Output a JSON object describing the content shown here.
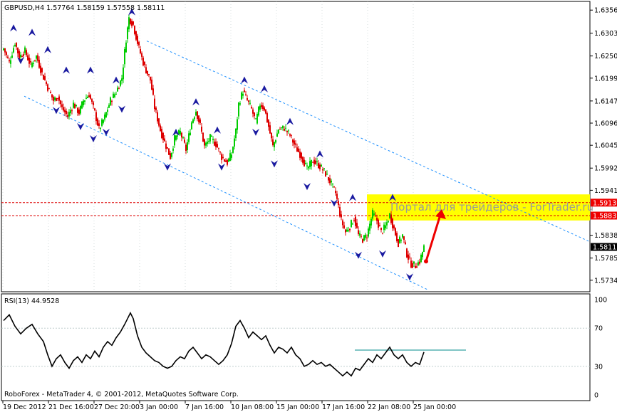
{
  "colors": {
    "background": "#ffffff",
    "grid": "#b8c8c8",
    "frame": "#000000",
    "candle_bull": "#00cc00",
    "candle_bear": "#dd0000",
    "channel": "#1e90ff",
    "fractal": "#1a1aa0",
    "level": "#dd0000",
    "target_zone": "#ffff00",
    "arrow": "#ee0000",
    "rsi_line": "#000000",
    "rsi_resistance": "#008b8b",
    "price_label_bg": "#000000",
    "level_label_bg": "#ee0000"
  },
  "header": {
    "symbol_text": "GBPUSD,H4  1.57764  1.58159  1.57558  1.58111"
  },
  "watermark": {
    "text": "Портал для трейдеров - ForTrader.ru"
  },
  "footer": {
    "copyright": "RoboForex - MetaTrader 4, © 2001-2012, MetaQuotes Software Corp."
  },
  "chart_data": [
    {
      "type": "candlestick",
      "symbol": "GBPUSD",
      "timeframe": "H4",
      "ohlc_last": {
        "open": 1.57764,
        "high": 1.58159,
        "low": 1.57558,
        "close": 1.58111
      },
      "current_price": "1.58111",
      "y_axis": {
        "range": [
          1.5708,
          1.6376
        ],
        "ticks": [
          "1.63560",
          "1.63030",
          "1.62505",
          "1.61995",
          "1.61470",
          "1.60960",
          "1.60450",
          "1.59925",
          "1.59415",
          "1.58380",
          "1.57855",
          "1.57345"
        ]
      },
      "x_axis": {
        "ticks": [
          "19 Dec 2012",
          "21 Dec 16:00",
          "27 Dec 20:00",
          "3 Jan 00:00",
          "7 Jan 16:00",
          "10 Jan 08:00",
          "15 Jan 00:00",
          "17 Jan 16:00",
          "22 Jan 08:00",
          "25 Jan 00:00"
        ]
      },
      "levels": [
        {
          "label": "1.59130",
          "value": 1.5913
        },
        {
          "label": "1.58832",
          "value": 1.58832
        }
      ],
      "target_zone": [
        1.5872,
        1.5932
      ],
      "close_path": [
        [
          0,
          1.6268
        ],
        [
          8,
          1.6235
        ],
        [
          16,
          1.6282
        ],
        [
          22,
          1.6248
        ],
        [
          30,
          1.6262
        ],
        [
          38,
          1.6228
        ],
        [
          46,
          1.625
        ],
        [
          54,
          1.621
        ],
        [
          62,
          1.6178
        ],
        [
          70,
          1.6148
        ],
        [
          76,
          1.6158
        ],
        [
          82,
          1.613
        ],
        [
          90,
          1.6112
        ],
        [
          98,
          1.614
        ],
        [
          106,
          1.612
        ],
        [
          112,
          1.6148
        ],
        [
          120,
          1.6162
        ],
        [
          128,
          1.612
        ],
        [
          134,
          1.6082
        ],
        [
          142,
          1.611
        ],
        [
          150,
          1.6148
        ],
        [
          158,
          1.6168
        ],
        [
          166,
          1.62
        ],
        [
          172,
          1.629
        ],
        [
          176,
          1.6338
        ],
        [
          182,
          1.6322
        ],
        [
          190,
          1.6268
        ],
        [
          198,
          1.6225
        ],
        [
          206,
          1.6195
        ],
        [
          212,
          1.6132
        ],
        [
          220,
          1.608
        ],
        [
          226,
          1.6052
        ],
        [
          234,
          1.6018
        ],
        [
          240,
          1.606
        ],
        [
          248,
          1.6075
        ],
        [
          256,
          1.6035
        ],
        [
          264,
          1.6098
        ],
        [
          270,
          1.6125
        ],
        [
          276,
          1.609
        ],
        [
          282,
          1.6042
        ],
        [
          290,
          1.6062
        ],
        [
          298,
          1.6048
        ],
        [
          306,
          1.6018
        ],
        [
          314,
          1.6005
        ],
        [
          320,
          1.6025
        ],
        [
          326,
          1.6078
        ],
        [
          330,
          1.614
        ],
        [
          336,
          1.617
        ],
        [
          342,
          1.6148
        ],
        [
          348,
          1.6128
        ],
        [
          354,
          1.6098
        ],
        [
          360,
          1.614
        ],
        [
          366,
          1.613
        ],
        [
          372,
          1.6088
        ],
        [
          378,
          1.6042
        ],
        [
          386,
          1.6082
        ],
        [
          394,
          1.6085
        ],
        [
          402,
          1.6068
        ],
        [
          410,
          1.604
        ],
        [
          418,
          1.602
        ],
        [
          426,
          1.599
        ],
        [
          434,
          1.601
        ],
        [
          442,
          1.6
        ],
        [
          450,
          1.5985
        ],
        [
          458,
          1.5962
        ],
        [
          466,
          1.5935
        ],
        [
          474,
          1.5872
        ],
        [
          480,
          1.5845
        ],
        [
          486,
          1.5858
        ],
        [
          492,
          1.5878
        ],
        [
          498,
          1.5838
        ],
        [
          504,
          1.5828
        ],
        [
          510,
          1.5838
        ],
        [
          518,
          1.5888
        ],
        [
          524,
          1.5872
        ],
        [
          530,
          1.5845
        ],
        [
          536,
          1.5858
        ],
        [
          542,
          1.5885
        ],
        [
          548,
          1.5852
        ],
        [
          554,
          1.582
        ],
        [
          560,
          1.5838
        ],
        [
          566,
          1.5795
        ],
        [
          572,
          1.5772
        ],
        [
          578,
          1.5768
        ],
        [
          584,
          1.5778
        ],
        [
          590,
          1.5811
        ]
      ],
      "fractals_up": [
        [
          14,
          1.6315
        ],
        [
          40,
          1.6305
        ],
        [
          62,
          1.6265
        ],
        [
          88,
          1.6218
        ],
        [
          122,
          1.6218
        ],
        [
          158,
          1.6195
        ],
        [
          180,
          1.6352
        ],
        [
          242,
          1.6075
        ],
        [
          270,
          1.6145
        ],
        [
          300,
          1.608
        ],
        [
          338,
          1.6195
        ],
        [
          366,
          1.6175
        ],
        [
          402,
          1.61
        ],
        [
          444,
          1.6025
        ],
        [
          490,
          1.5925
        ],
        [
          546,
          1.5925
        ]
      ],
      "fractals_down": [
        [
          24,
          1.624
        ],
        [
          74,
          1.6125
        ],
        [
          108,
          1.6088
        ],
        [
          126,
          1.606
        ],
        [
          144,
          1.6075
        ],
        [
          166,
          1.6128
        ],
        [
          230,
          1.5995
        ],
        [
          306,
          1.5995
        ],
        [
          354,
          1.6075
        ],
        [
          380,
          1.6002
        ],
        [
          426,
          1.595
        ],
        [
          464,
          1.5912
        ],
        [
          498,
          1.5792
        ],
        [
          532,
          1.5795
        ],
        [
          570,
          1.5742
        ]
      ],
      "channel_lines": [
        {
          "from": [
            206,
            1.6285
          ],
          "to": [
            828,
            1.5823
          ]
        },
        {
          "from": [
            34,
            1.6158
          ],
          "to": [
            600,
            1.5713
          ]
        }
      ],
      "arrow": {
        "from": [
          598,
          1.5778
        ],
        "to": [
          620,
          1.5898
        ]
      }
    },
    {
      "type": "line",
      "indicator": "RSI",
      "label": "RSI(13) 44.9528",
      "value": 44.9528,
      "y_axis": {
        "range": [
          0,
          100
        ],
        "ticks": [
          "100",
          "70",
          "30",
          "0"
        ]
      },
      "levels": [
        70,
        30
      ],
      "resistance_line": {
        "from": [
          498,
          47
        ],
        "to": [
          654,
          47
        ]
      },
      "series": [
        [
          0,
          78
        ],
        [
          8,
          84
        ],
        [
          16,
          72
        ],
        [
          24,
          64
        ],
        [
          32,
          70
        ],
        [
          40,
          74
        ],
        [
          48,
          64
        ],
        [
          56,
          56
        ],
        [
          62,
          42
        ],
        [
          68,
          30
        ],
        [
          74,
          38
        ],
        [
          80,
          42
        ],
        [
          86,
          34
        ],
        [
          92,
          28
        ],
        [
          98,
          36
        ],
        [
          104,
          40
        ],
        [
          110,
          34
        ],
        [
          116,
          42
        ],
        [
          122,
          38
        ],
        [
          128,
          46
        ],
        [
          134,
          40
        ],
        [
          140,
          50
        ],
        [
          146,
          56
        ],
        [
          152,
          52
        ],
        [
          158,
          60
        ],
        [
          164,
          66
        ],
        [
          170,
          74
        ],
        [
          174,
          80
        ],
        [
          178,
          86
        ],
        [
          182,
          80
        ],
        [
          188,
          62
        ],
        [
          194,
          50
        ],
        [
          200,
          44
        ],
        [
          206,
          40
        ],
        [
          212,
          36
        ],
        [
          218,
          34
        ],
        [
          224,
          30
        ],
        [
          230,
          28
        ],
        [
          236,
          30
        ],
        [
          242,
          36
        ],
        [
          248,
          40
        ],
        [
          254,
          38
        ],
        [
          260,
          46
        ],
        [
          266,
          50
        ],
        [
          272,
          44
        ],
        [
          278,
          38
        ],
        [
          284,
          42
        ],
        [
          290,
          40
        ],
        [
          296,
          36
        ],
        [
          302,
          32
        ],
        [
          308,
          36
        ],
        [
          314,
          42
        ],
        [
          320,
          54
        ],
        [
          326,
          72
        ],
        [
          332,
          78
        ],
        [
          338,
          70
        ],
        [
          344,
          60
        ],
        [
          350,
          66
        ],
        [
          356,
          62
        ],
        [
          362,
          58
        ],
        [
          368,
          62
        ],
        [
          374,
          52
        ],
        [
          380,
          44
        ],
        [
          386,
          50
        ],
        [
          392,
          48
        ],
        [
          398,
          44
        ],
        [
          404,
          50
        ],
        [
          410,
          42
        ],
        [
          416,
          38
        ],
        [
          422,
          30
        ],
        [
          428,
          32
        ],
        [
          434,
          36
        ],
        [
          440,
          32
        ],
        [
          446,
          34
        ],
        [
          452,
          30
        ],
        [
          458,
          32
        ],
        [
          464,
          28
        ],
        [
          470,
          24
        ],
        [
          476,
          20
        ],
        [
          482,
          24
        ],
        [
          488,
          20
        ],
        [
          494,
          28
        ],
        [
          500,
          26
        ],
        [
          506,
          32
        ],
        [
          512,
          38
        ],
        [
          518,
          34
        ],
        [
          524,
          42
        ],
        [
          530,
          38
        ],
        [
          536,
          44
        ],
        [
          542,
          50
        ],
        [
          548,
          42
        ],
        [
          554,
          38
        ],
        [
          560,
          42
        ],
        [
          566,
          34
        ],
        [
          572,
          30
        ],
        [
          578,
          34
        ],
        [
          584,
          32
        ],
        [
          590,
          44.95
        ]
      ]
    }
  ]
}
